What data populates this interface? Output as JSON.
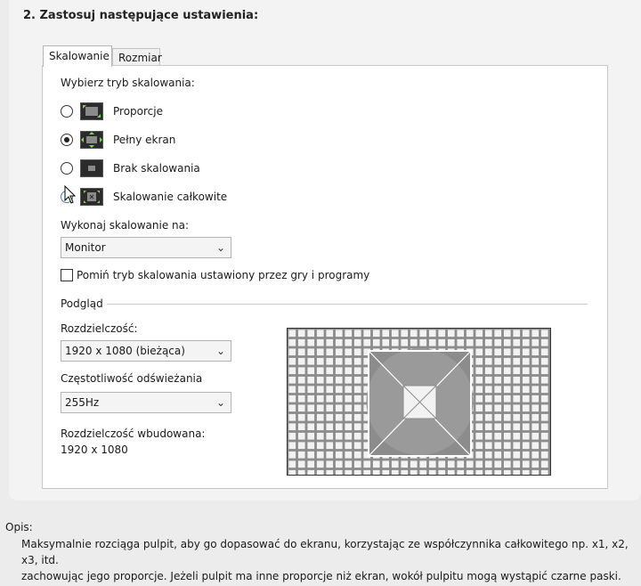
{
  "section": {
    "title": "2. Zastosuj następujące ustawienia:"
  },
  "tabs": [
    {
      "label": "Skalowanie",
      "active": true
    },
    {
      "label": "Rozmiar",
      "active": false
    }
  ],
  "scaling": {
    "prompt": "Wybierz tryb skalowania:",
    "modes": [
      {
        "label": "Proporcje",
        "checked": false,
        "icon": "aspect-ratio-icon"
      },
      {
        "label": "Pełny ekran",
        "checked": true,
        "icon": "full-screen-icon"
      },
      {
        "label": "Brak skalowania",
        "checked": false,
        "icon": "no-scaling-icon"
      },
      {
        "label": "Skalowanie całkowite",
        "checked": false,
        "icon": "integer-scaling-icon"
      }
    ],
    "perform_on_label": "Wykonaj skalowanie na:",
    "perform_on_value": "Monitor",
    "override_label": "Pomiń tryb skalowania ustawiony przez gry i programy",
    "override_checked": false
  },
  "preview": {
    "heading": "Podgląd",
    "resolution_label": "Rozdzielczość:",
    "resolution_value": "1920 x 1080 (bieżąca)",
    "refresh_label": "Częstotliwość odświeżania",
    "refresh_value": "255Hz",
    "native_label": "Rozdzielczość wbudowana:",
    "native_value": "1920 x 1080"
  },
  "description": {
    "label": "Opis:",
    "line1": "Maksymalnie rozciąga pulpit, aby go dopasować do ekranu, korzystając ze współczynnika całkowitego np. x1, x2, x3, itd.",
    "line2": "zachowując jego proporcje. Jeżeli pulpit ma inne proporcje niż ekran, wokół pulpitu mogą wystąpić czarne paski."
  },
  "colors": {
    "preview_grid": "#8c8c8c",
    "preview_lines": "#ffffff",
    "preview_circle": "#9a9a9a",
    "selection": "#222222"
  }
}
